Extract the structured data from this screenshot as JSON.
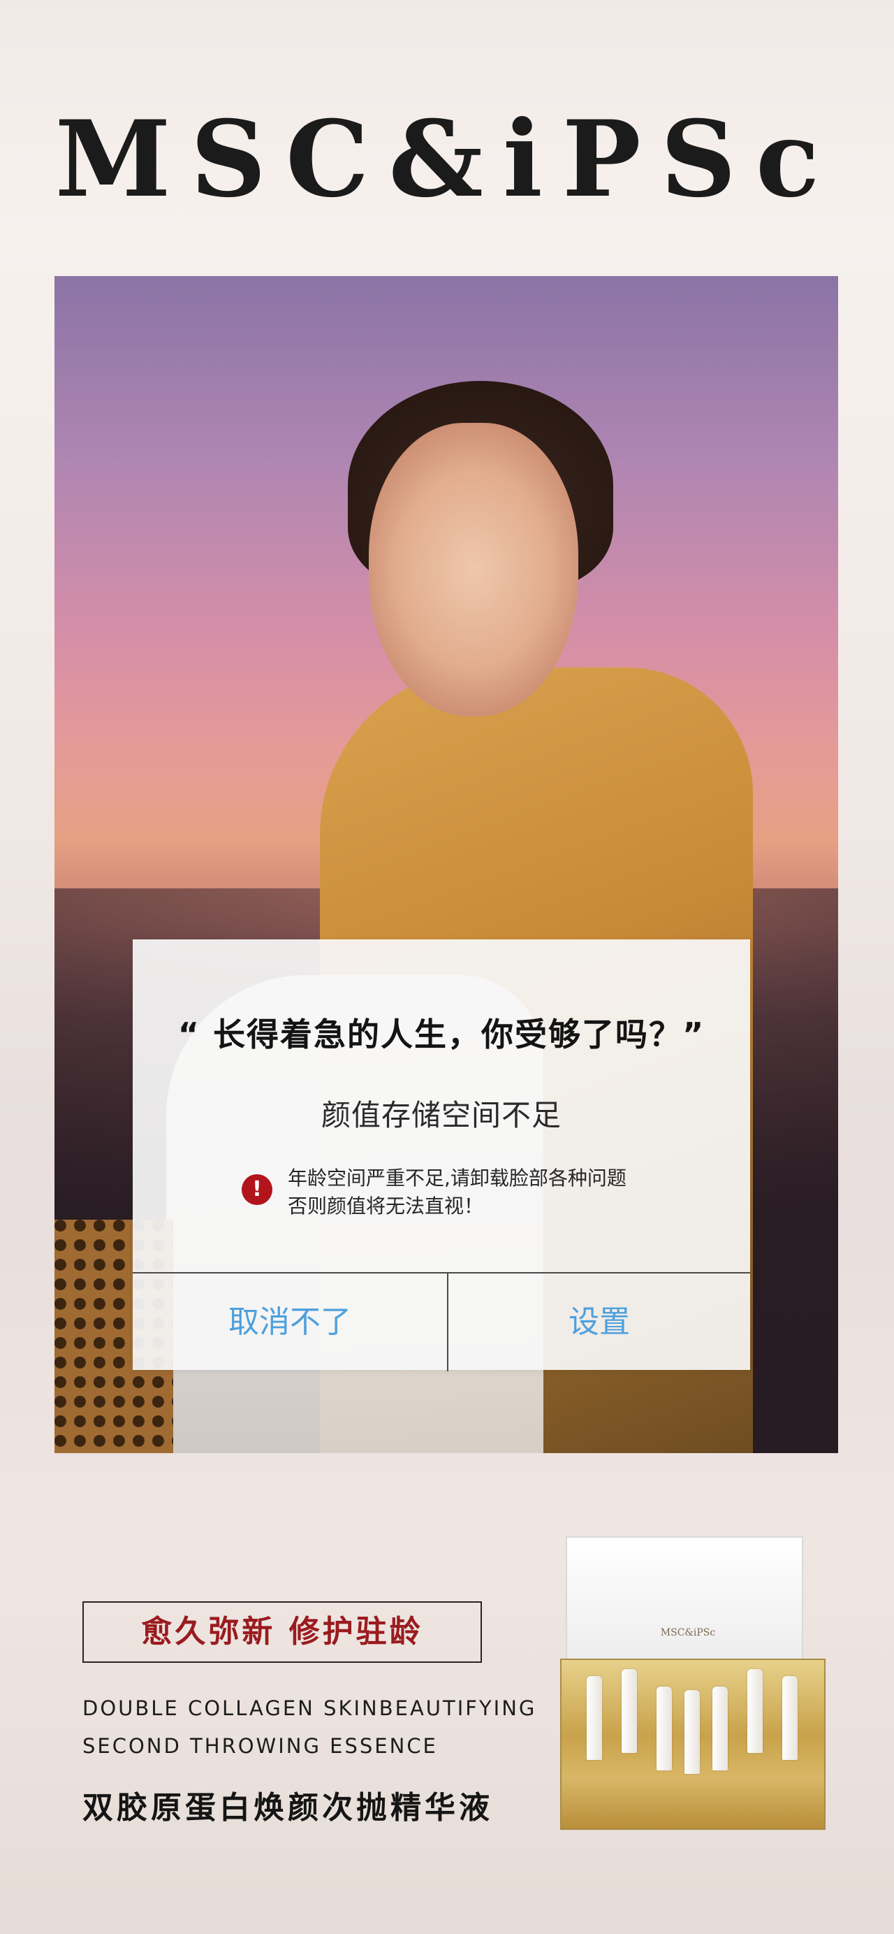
{
  "brand": {
    "title": "MSC&iPSc"
  },
  "hero": {
    "image_desc_name": "model-portrait"
  },
  "dialog": {
    "quote": "“ 长得着急的人生，你受够了吗？”",
    "subtitle": "颜值存储空间不足",
    "warning_line1": "年龄空间严重不足,请卸载脸部各种问题",
    "warning_line2": "否则颜值将无法直视！",
    "warning_icon": "!",
    "cancel_label": "取消不了",
    "settings_label": "设置",
    "button_color": "#4ea0dd",
    "warning_color": "#b1141b"
  },
  "product_section": {
    "tagline": "愈久弥新  修护驻龄",
    "english_line1": "DOUBLE  COLLAGEN  SKINBEAUTIFYING",
    "english_line2": "SECOND  THROWING  ESSENCE",
    "chinese_name": "双胶原蛋白焕颜次抛精华液",
    "box_logo": "MSC&iPSc",
    "tagline_color": "#9a1b1f"
  }
}
